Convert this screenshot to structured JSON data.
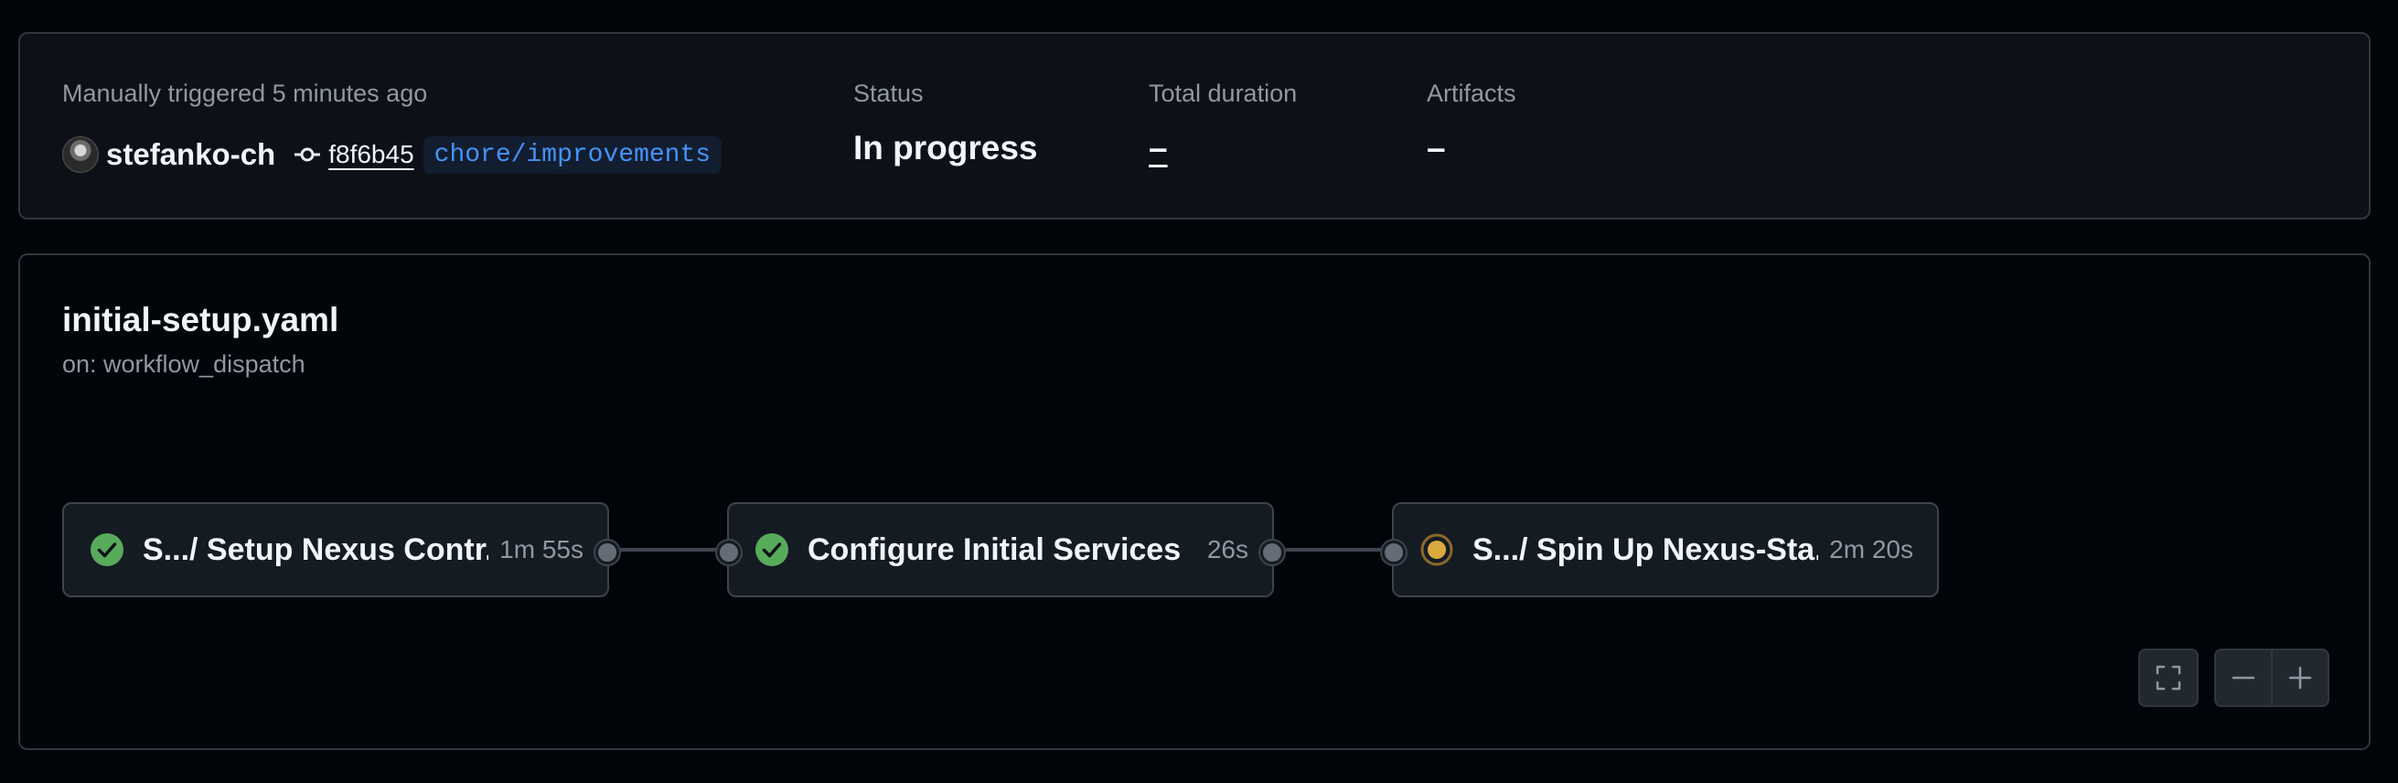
{
  "summary": {
    "trigger_text": "Manually triggered 5 minutes ago",
    "actor": "stefanko-ch",
    "commit_sha": "f8f6b45",
    "branch": "chore/improvements",
    "status_label": "Status",
    "status_value": "In progress",
    "duration_label": "Total duration",
    "duration_value": "–",
    "artifacts_label": "Artifacts",
    "artifacts_value": "–"
  },
  "workflow": {
    "file": "initial-setup.yaml",
    "trigger": "on: workflow_dispatch",
    "jobs": [
      {
        "name": "S.../ Setup Nexus Contr...",
        "duration": "1m 55s",
        "status": "success"
      },
      {
        "name": "Configure Initial Services",
        "duration": "26s",
        "status": "success"
      },
      {
        "name": "S.../ Spin Up Nexus-Sta...",
        "duration": "2m 20s",
        "status": "in_progress"
      }
    ]
  },
  "icons": {
    "success": "check-circle-icon",
    "in_progress": "in-progress-dot-icon",
    "fullscreen": "fullscreen-icon",
    "zoom_out": "minus-icon",
    "zoom_in": "plus-icon",
    "commit": "git-commit-icon"
  },
  "colors": {
    "success": "#57ab5a",
    "in_progress": "#daaa3f",
    "link": "#4493f8"
  }
}
